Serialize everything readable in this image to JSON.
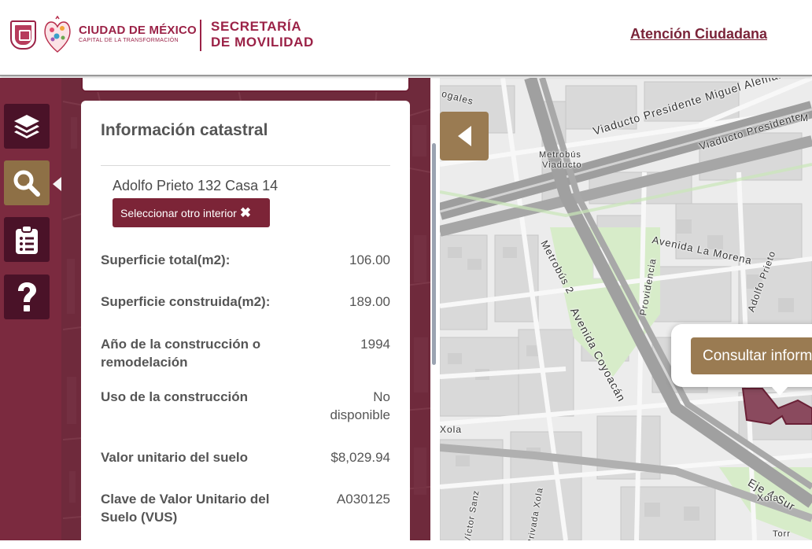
{
  "header": {
    "brand_title": "CIUDAD DE MÉXICO",
    "brand_subtitle": "CAPITAL DE LA TRANSFORMACIÓN",
    "secretaria_line1": "SECRETARÍA",
    "secretaria_line2": "DE MOVILIDAD",
    "attention_link": "Atención Ciudadana"
  },
  "sidebar": {
    "buttons": [
      {
        "icon": "layers-icon",
        "active": false
      },
      {
        "icon": "search-icon",
        "active": true
      },
      {
        "icon": "clipboard-icon",
        "active": false
      },
      {
        "icon": "question-icon",
        "active": false
      }
    ]
  },
  "panel": {
    "title": "Información catastral",
    "address": "Adolfo Prieto 132 Casa 14",
    "change_interior_button": "Seleccionar otro interior",
    "change_interior_icon": "close-icon",
    "rows": [
      {
        "label": "Superficie total(m2):",
        "value": "106.00"
      },
      {
        "label": "Superficie construida(m2):",
        "value": "189.00"
      },
      {
        "label": "Año de la construcción o remodelación",
        "value": "1994"
      },
      {
        "label": "Uso de la construcción",
        "value": "No disponible"
      },
      {
        "label": "Valor unitario del suelo",
        "value": "$8,029.94"
      },
      {
        "label": "Clave de Valor Unitario del Suelo (VUS)",
        "value": "A030125"
      }
    ]
  },
  "map": {
    "labels": {
      "gales": "ogales",
      "metrobus": "Metrobús",
      "viaducto": "Viaducto",
      "viaducto_pma": "Viaducto Presidente Miguel Alemán",
      "viaducto_presidente": "Viaducto Presidente",
      "metrobus_2": "Metrobús 2",
      "avenida_la_morena": "Avenida La Morena",
      "adolfo_prieto": "Adolfo Prieto",
      "providencia": "Providencia",
      "avenida_coyoacan": "Avenida Coyoacán",
      "xola_left": "Xola",
      "eje_4_sur": "Eje 4 Sur",
      "xola_right": "Xola",
      "torr": "Torr",
      "victor_sanz": "Víctor Sanz",
      "privada_xola": "Privada Xola",
      "m_edge": "M"
    },
    "popup_button": "Consultar información"
  }
}
